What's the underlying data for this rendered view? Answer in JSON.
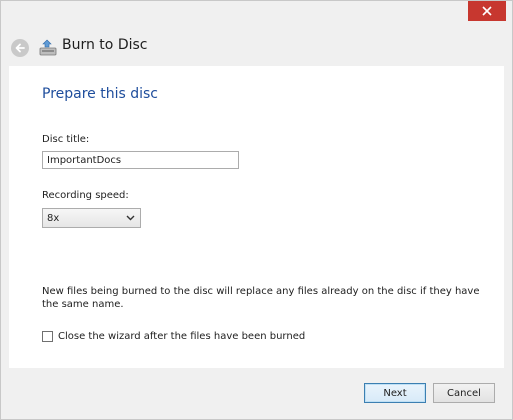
{
  "window": {
    "title": "Burn to Disc"
  },
  "page": {
    "heading": "Prepare this disc",
    "disc_title_label": "Disc title:",
    "disc_title_value": "ImportantDocs",
    "recording_speed_label": "Recording speed:",
    "recording_speed_value": "8x",
    "note": "New files being burned to the disc will replace any files already on the disc if they have the same name.",
    "close_wizard_label": "Close the wizard after the files have been burned",
    "close_wizard_checked": false
  },
  "buttons": {
    "next": "Next",
    "cancel": "Cancel"
  },
  "icons": {
    "close": "close-icon",
    "back": "back-arrow-icon",
    "app": "disc-burner-icon",
    "dropdown": "chevron-down-icon"
  },
  "colors": {
    "close_button": "#c7372f",
    "heading": "#1e4d9c",
    "primary_button_border": "#3c7fb1"
  }
}
